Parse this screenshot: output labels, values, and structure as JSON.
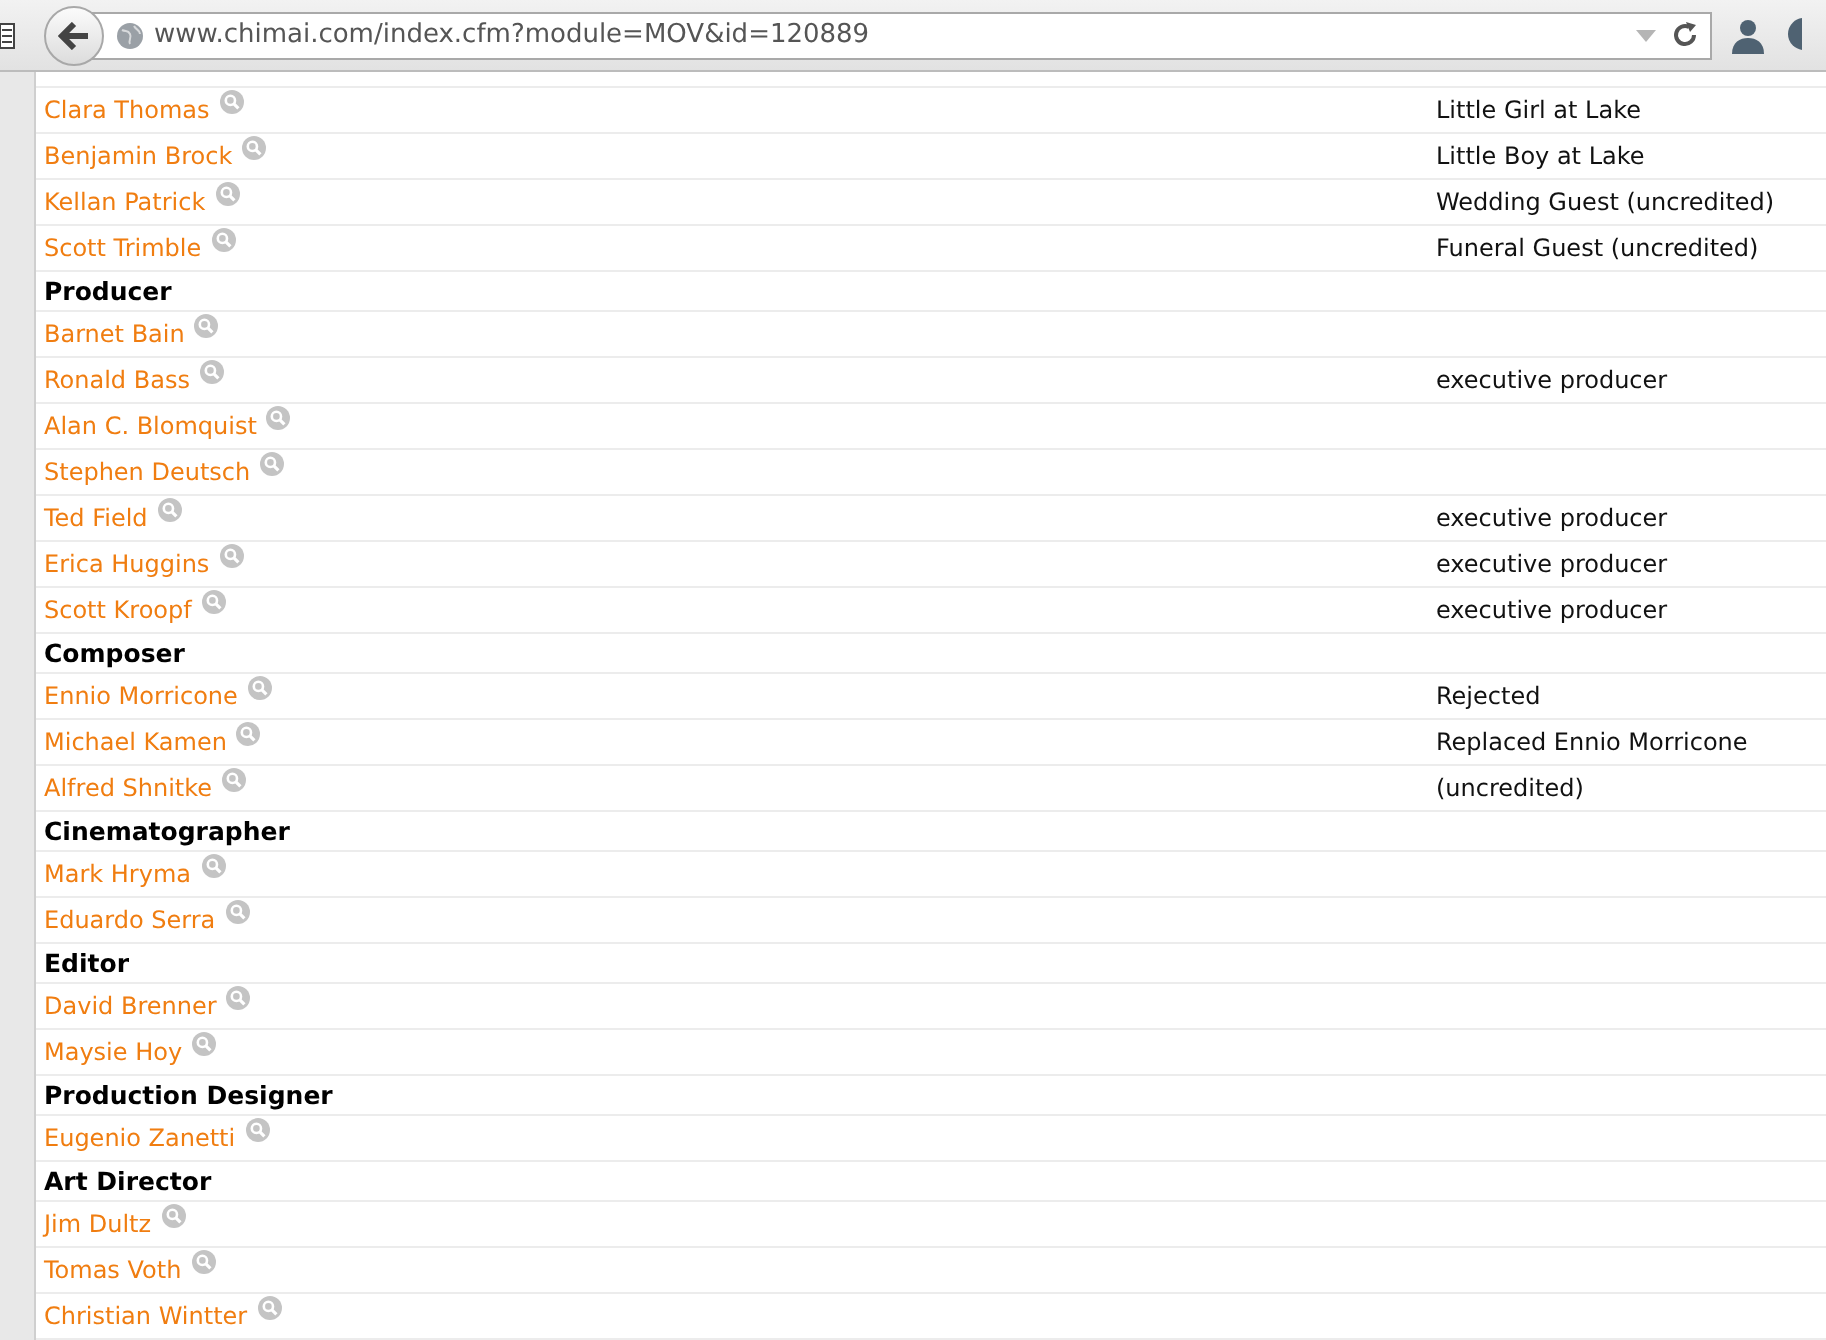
{
  "toolbar": {
    "url": "www.chimai.com/index.cfm?module=MOV&id=120889"
  },
  "credits": [
    {
      "kind": "person",
      "name": "Clara Thomas",
      "role": "Little Girl at Lake"
    },
    {
      "kind": "person",
      "name": "Benjamin Brock",
      "role": "Little Boy at Lake"
    },
    {
      "kind": "person",
      "name": "Kellan Patrick",
      "role": "Wedding Guest (uncredited)"
    },
    {
      "kind": "person",
      "name": "Scott Trimble",
      "role": "Funeral Guest (uncredited)"
    },
    {
      "kind": "heading",
      "name": "Producer"
    },
    {
      "kind": "person",
      "name": "Barnet Bain"
    },
    {
      "kind": "person",
      "name": "Ronald Bass",
      "role": "executive producer"
    },
    {
      "kind": "person",
      "name": "Alan C. Blomquist"
    },
    {
      "kind": "person",
      "name": "Stephen Deutsch"
    },
    {
      "kind": "person",
      "name": "Ted Field",
      "role": "executive producer"
    },
    {
      "kind": "person",
      "name": "Erica Huggins",
      "role": "executive producer"
    },
    {
      "kind": "person",
      "name": "Scott Kroopf",
      "role": "executive producer"
    },
    {
      "kind": "heading",
      "name": "Composer"
    },
    {
      "kind": "person",
      "name": "Ennio Morricone",
      "role": "Rejected"
    },
    {
      "kind": "person",
      "name": "Michael Kamen",
      "role": "Replaced Ennio Morricone"
    },
    {
      "kind": "person",
      "name": "Alfred Shnitke",
      "role": "(uncredited)"
    },
    {
      "kind": "heading",
      "name": "Cinematographer"
    },
    {
      "kind": "person",
      "name": "Mark Hryma"
    },
    {
      "kind": "person",
      "name": "Eduardo Serra"
    },
    {
      "kind": "heading",
      "name": "Editor"
    },
    {
      "kind": "person",
      "name": "David Brenner"
    },
    {
      "kind": "person",
      "name": "Maysie Hoy"
    },
    {
      "kind": "heading",
      "name": "Production Designer"
    },
    {
      "kind": "person",
      "name": "Eugenio Zanetti"
    },
    {
      "kind": "heading",
      "name": "Art Director"
    },
    {
      "kind": "person",
      "name": "Jim Dultz"
    },
    {
      "kind": "person",
      "name": "Tomas Voth"
    },
    {
      "kind": "person",
      "name": "Christian Wintter"
    }
  ]
}
